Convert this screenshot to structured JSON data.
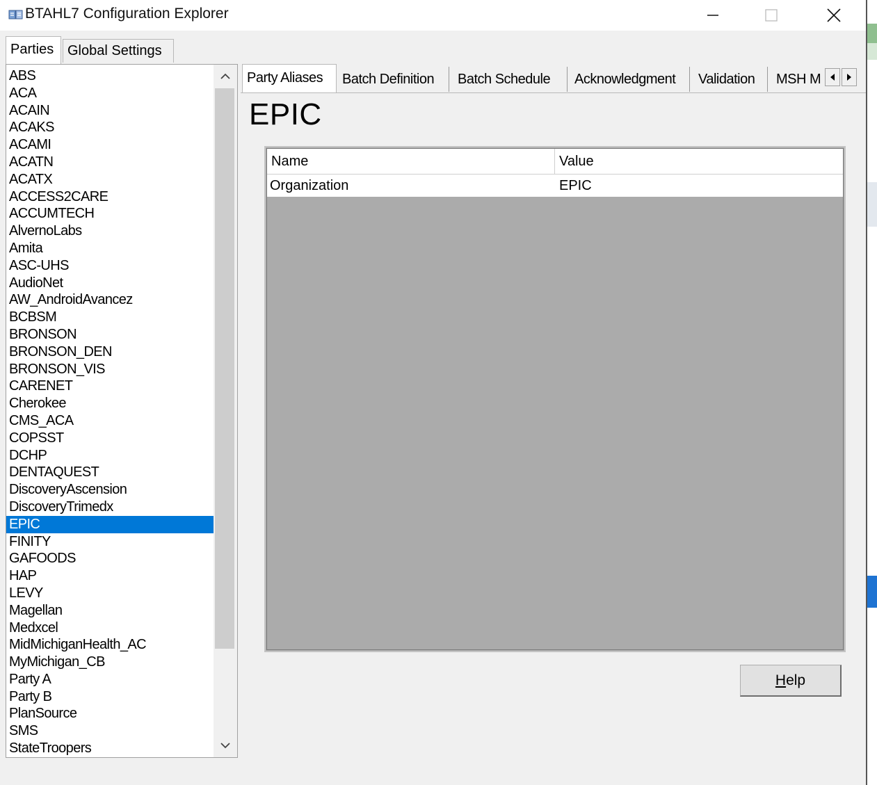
{
  "window": {
    "title": "BTAHL7 Configuration Explorer",
    "controls": {
      "minimize": "—",
      "maximize": "☐",
      "close": "✕"
    }
  },
  "outer_tabs": [
    "Parties",
    "Global Settings"
  ],
  "parties": {
    "items": [
      "ABS",
      "ACA",
      "ACAIN",
      "ACAKS",
      "ACAMI",
      "ACATN",
      "ACATX",
      "ACCESS2CARE",
      "ACCUMTECH",
      "AlvernoLabs",
      "Amita",
      "ASC-UHS",
      "AudioNet",
      "AW_AndroidAvancez",
      "BCBSM",
      "BRONSON",
      "BRONSON_DEN",
      "BRONSON_VIS",
      "CARENET",
      "Cherokee",
      "CMS_ACA",
      "COPSST",
      "DCHP",
      "DENTAQUEST",
      "DiscoveryAscension",
      "DiscoveryTrimedx",
      "EPIC",
      "FINITY",
      "GAFOODS",
      "HAP",
      "LEVY",
      "Magellan",
      "Medxcel",
      "MidMichiganHealth_AC",
      "MyMichigan_CB",
      "Party A",
      "Party B",
      "PlanSource",
      "SMS",
      "StateTroopers"
    ],
    "selected": "EPIC"
  },
  "inner_tabs": [
    "Party Aliases",
    "Batch Definition",
    "Batch Schedule",
    "Acknowledgment",
    "Validation",
    "MSH M"
  ],
  "page": {
    "party_name": "EPIC",
    "grid": {
      "columns": [
        "Name",
        "Value"
      ],
      "rows": [
        {
          "name": "Organization",
          "value": "EPIC"
        }
      ]
    },
    "help_button": {
      "underlined": "H",
      "rest": "elp"
    }
  },
  "colors": {
    "selection": "#0078d7",
    "grid_background": "#ababab",
    "window_background": "#f0f0f0"
  }
}
